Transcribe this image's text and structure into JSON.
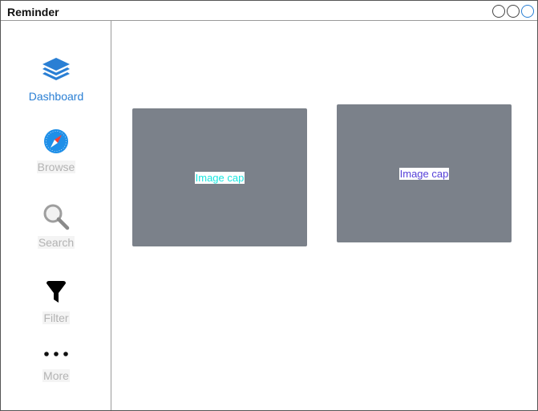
{
  "window": {
    "title": "Reminder",
    "controls": [
      "circle-button",
      "circle-button",
      "circle-button-active"
    ]
  },
  "sidebar": {
    "items": [
      {
        "label": "Dashboard",
        "icon": "layers-icon",
        "active": true
      },
      {
        "label": "Browse",
        "icon": "compass-icon",
        "active": false
      },
      {
        "label": "Search",
        "icon": "search-icon",
        "active": false
      },
      {
        "label": "Filter",
        "icon": "filter-icon",
        "active": false
      },
      {
        "label": "More",
        "icon": "more-icon",
        "active": false
      }
    ]
  },
  "main": {
    "cards": [
      {
        "caption": "Image cap",
        "caption_color": "#19e6e0"
      },
      {
        "caption": "Image cap",
        "caption_color": "#5540d8"
      }
    ]
  },
  "colors": {
    "accent": "#2a7fd4",
    "card_bg": "#7b818a",
    "inactive_label": "#b3b3b3"
  }
}
